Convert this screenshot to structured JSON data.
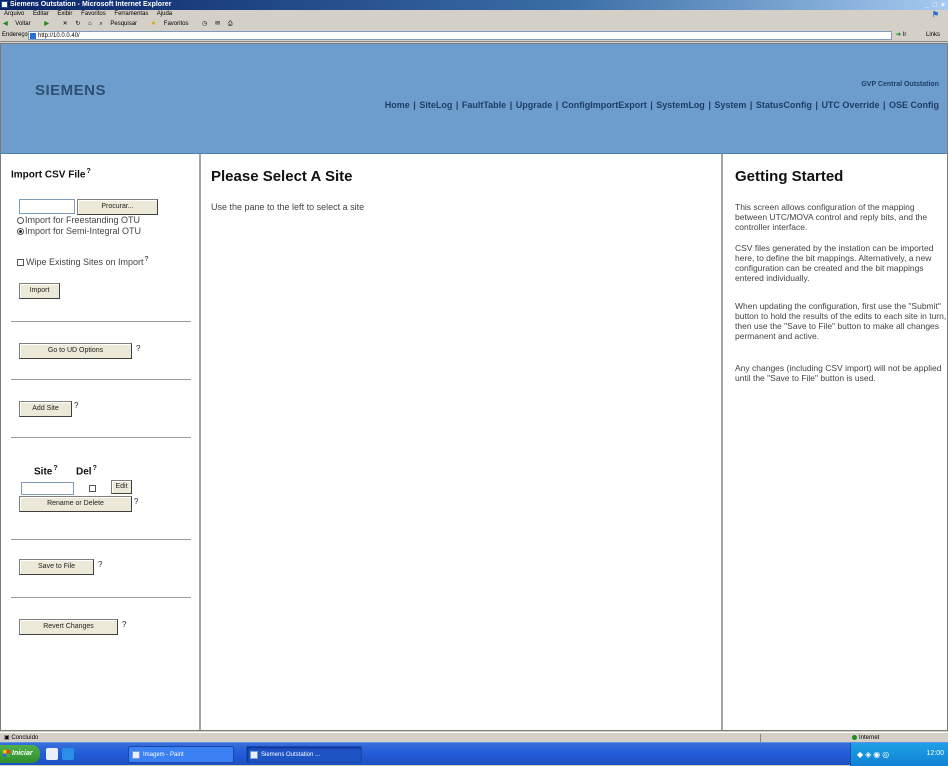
{
  "browser": {
    "title": "Siemens Outstation - Microsoft Internet Explorer",
    "window_buttons": "_ □ ×",
    "menu": [
      "Arquivo",
      "Editar",
      "Exibir",
      "Favoritos",
      "Ferramentas",
      "Ajuda"
    ],
    "toolbar": {
      "back": "Voltar",
      "search": "Pesquisar",
      "favorites": "Favoritos"
    },
    "address": {
      "label": "Endereço",
      "url": "http://10.0.0.40/",
      "go": "Ir",
      "links": "Links"
    }
  },
  "header": {
    "brand": "SIEMENS",
    "station": "GVP Central Outstation",
    "nav": [
      "Home",
      "SiteLog",
      "FaultTable",
      "Upgrade",
      "ConfigImportExport",
      "SystemLog",
      "System",
      "StatusConfig",
      "UTC Override",
      "OSE Config"
    ]
  },
  "left": {
    "import_heading": "Import CSV File",
    "browse_button": "Procurar...",
    "radio_freestanding": "Import for Freestanding OTU",
    "radio_semi_integral": "Import for Semi-Integral OTU",
    "wipe_label": "Wipe Existing Sites on Import",
    "import_button": "Import",
    "ud_options_button": "Go to UD Options",
    "add_site_button": "Add Site",
    "site_label": "Site",
    "del_label": "Del",
    "edit_button": "Edit",
    "rename_button": "Rename or Delete",
    "save_button": "Save to File",
    "revert_button": "Revert Changes",
    "help_mark": "?"
  },
  "center": {
    "title": "Please Select A Site",
    "text": "Use the pane to the left to select a site"
  },
  "right": {
    "title": "Getting Started",
    "paragraphs": [
      "This screen allows configuration of the mapping between UTC/MOVA control and reply bits, and the controller interface.",
      "CSV files generated by the instation can be imported here, to define the bit mappings. Alternatively, a new configuration can be created and the bit mappings entered individually.",
      "When updating the configuration, first use the \"Submit\" button to hold the results of the edits to each site in turn, then use the \"Save to File\" button to make all changes permanent and active.",
      "Any changes (including CSV import) will not be applied until the \"Save to File\" button is used."
    ]
  },
  "status": {
    "left": "Concluído",
    "zone": "Internet"
  },
  "taskbar": {
    "start": "Iniciar",
    "tasks": [
      "Imagem - Paint",
      "Siemens Outstation ..."
    ],
    "clock": "12:00"
  }
}
